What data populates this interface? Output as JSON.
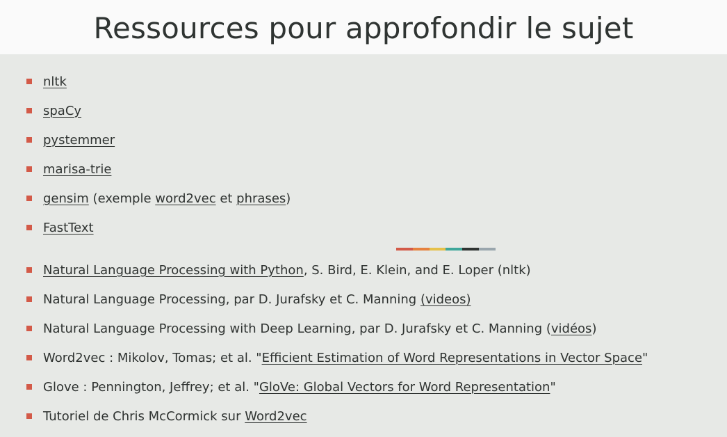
{
  "title": "Ressources pour approfondir le sujet",
  "tools": [
    {
      "link": "nltk"
    },
    {
      "link": "spaCy"
    },
    {
      "link": "pystemmer"
    },
    {
      "link": "marisa-trie"
    },
    {
      "link": "gensim",
      "text1": " (exemple ",
      "link2": "word2vec",
      "text2": " et ",
      "link3": "phrases",
      "text3": ")"
    },
    {
      "link": "FastText"
    }
  ],
  "divider_colors": [
    "#d35a48",
    "#e6823f",
    "#e6c14a",
    "#3fa79a",
    "#2f3432",
    "#9aa6ad"
  ],
  "refs": [
    {
      "link": "Natural Language Processing with Python",
      "after": ", S. Bird, E. Klein, and E. Loper (nltk)"
    },
    {
      "before": "Natural Language Processing, par D. Jurafsky et C. Manning ",
      "link": "(videos)"
    },
    {
      "before": "Natural Language Processing with Deep Learning, par D. Jurafsky et C. Manning (",
      "link": "vidéos",
      "after": ")"
    },
    {
      "before": "Word2vec : Mikolov, Tomas; et al. \"",
      "link": "Efficient Estimation of Word Representations in Vector Space",
      "after": "\""
    },
    {
      "before": "Glove : Pennington, Jeffrey; et al. \"",
      "link": "GloVe: Global Vectors for Word Representation",
      "after": "\""
    },
    {
      "before": "Tutoriel de Chris McCormick sur ",
      "link": "Word2vec"
    }
  ]
}
